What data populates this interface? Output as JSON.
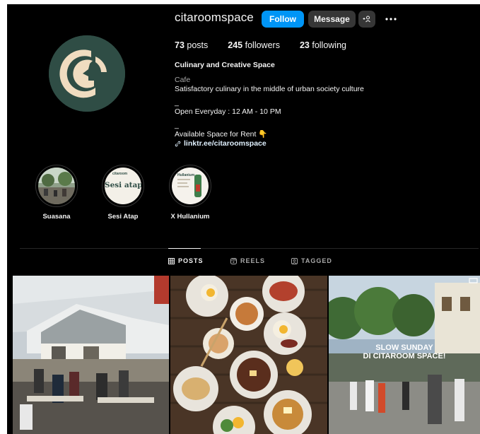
{
  "profile": {
    "username": "citaroomspace",
    "follow_label": "Follow",
    "message_label": "Message",
    "add_user_icon": "person-add-icon",
    "more_icon": "more-horizontal-icon",
    "avatar_colors": {
      "bg": "#2f4d45",
      "mark": "#f0dcc0"
    }
  },
  "stats": {
    "posts_count": "73",
    "posts_label": "posts",
    "followers_count": "245",
    "followers_label": "followers",
    "following_count": "23",
    "following_label": "following"
  },
  "bio": {
    "name": "Culinary and Creative Space",
    "category": "Cafe",
    "line1": "Satisfactory culinary in the middle of urban society culture",
    "sep1": "_",
    "line2": "Open Everyday : 12 AM - 10 PM",
    "sep2": "_",
    "line3": "Available Space for Rent 👇",
    "link": "linktr.ee/citaroomspace"
  },
  "highlights": [
    {
      "label": "Suasana"
    },
    {
      "label": "Sesi Atap",
      "text": "Sesi atap",
      "brand": "citaroom"
    },
    {
      "label": "X Hullanium",
      "brand": "Hullanium"
    }
  ],
  "tabs": [
    {
      "label": "POSTS",
      "icon": "grid-icon",
      "active": true
    },
    {
      "label": "REELS",
      "icon": "reels-icon",
      "active": false
    },
    {
      "label": "TAGGED",
      "icon": "tagged-icon",
      "active": false
    }
  ],
  "posts": [
    {
      "kind": "photo"
    },
    {
      "kind": "photo"
    },
    {
      "kind": "reel",
      "overlay_line1": "SLOW SUNDAY",
      "overlay_line2": "DI CITAROOM SPACE!"
    }
  ],
  "colors": {
    "accent": "#0095f6",
    "button_secondary": "#363636",
    "background": "#000000",
    "text": "#f5f5f5",
    "muted": "#a8a8a8",
    "link": "#e0f1ff"
  }
}
